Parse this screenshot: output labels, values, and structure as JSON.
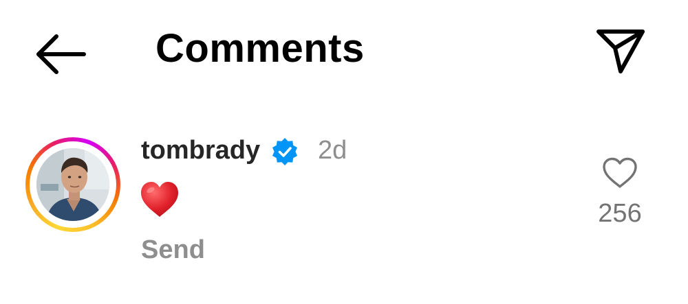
{
  "header": {
    "title": "Comments",
    "back_icon": "arrow-left-icon",
    "send_icon": "paper-plane-icon"
  },
  "comment": {
    "username": "tombrady",
    "verified": true,
    "time_ago": "2d",
    "text_emoji": "red-heart-emoji",
    "reply_label": "Send",
    "like_count": "256",
    "colors": {
      "verified_badge": "#0095f6",
      "heart": "#e0202a",
      "secondary_text": "#8e8e8e"
    }
  }
}
